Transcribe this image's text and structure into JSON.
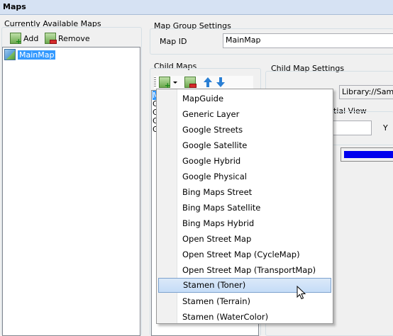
{
  "window": {
    "title": "Maps"
  },
  "left_panel": {
    "title": "Currently Available Maps",
    "add_label": "Add",
    "remove_label": "Remove",
    "items": [
      {
        "label": "MainMap",
        "selected": true
      }
    ]
  },
  "map_group": {
    "title": "Map Group Settings",
    "map_id_label": "Map ID",
    "map_id_value": "MainMap"
  },
  "child_maps": {
    "title": "Child Maps",
    "list_partial": [
      "M",
      "G",
      "G",
      "G",
      "G"
    ]
  },
  "child_settings": {
    "title": "Child Map Settings",
    "resource_partial": "Library://Samp",
    "initial_view_partial": "tial View",
    "y_label": "Y",
    "color_swatch": "#0000ee"
  },
  "context_menu": {
    "items": [
      "MapGuide",
      "Generic Layer",
      "Google Streets",
      "Google Satellite",
      "Google Hybrid",
      "Google Physical",
      "Bing Maps Street",
      "Bing Maps Satellite",
      "Bing Maps Hybrid",
      "Open Street Map",
      "Open Street Map (CycleMap)",
      "Open Street Map (TransportMap)",
      "Stamen (Toner)",
      "Stamen (Terrain)",
      "Stamen (WaterColor)"
    ],
    "hovered_index": 12
  }
}
